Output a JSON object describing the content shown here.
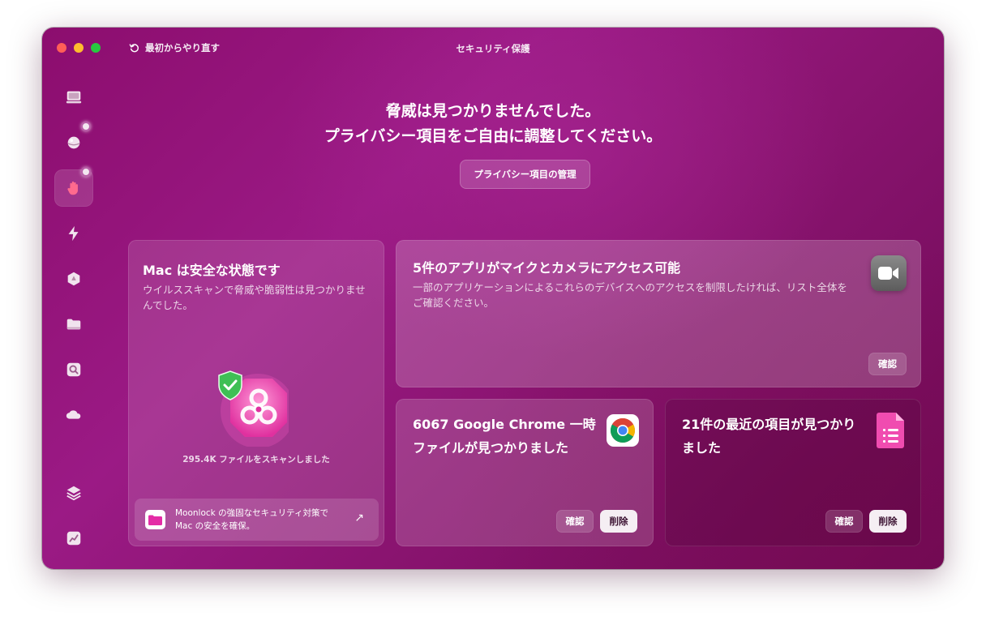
{
  "window": {
    "title": "セキュリティ保護",
    "restart_label": "最初からやり直す"
  },
  "sidebar": {
    "items": [
      {
        "icon": "monitor-icon"
      },
      {
        "icon": "cleanup-ball-icon",
        "badge": true
      },
      {
        "icon": "hand-privacy-icon",
        "badge": true,
        "active": true
      },
      {
        "icon": "lightning-icon"
      },
      {
        "icon": "apps-icon"
      },
      {
        "icon": "folder-icon"
      },
      {
        "icon": "magnifier-icon"
      },
      {
        "icon": "cloud-icon"
      },
      {
        "icon": "layers-icon"
      },
      {
        "icon": "chart-icon"
      }
    ]
  },
  "hero": {
    "line1": "脅威は見つかりませんでした。",
    "line2": "プライバシー項目をご自由に調整してください。",
    "manage_button": "プライバシー項目の管理"
  },
  "mac_card": {
    "title": "Mac は安全な状態です",
    "description": "ウイルススキャンで脅威や脆弱性は見つかりませんでした。",
    "scan_text": "295.4K ファイルをスキャンしました",
    "moonlock_line1": "Moonlock の強固なセキュリティ対策で",
    "moonlock_line2": "Mac の安全を確保。",
    "moonlock_arrow": "↗"
  },
  "mic_card": {
    "title": "5件のアプリがマイクとカメラにアクセス可能",
    "description": "一部のアプリケーションによるこれらのデバイスへのアクセスを制限したければ、リスト全体をご確認ください。",
    "review_button": "確認"
  },
  "chrome_card": {
    "title": "6067 Google Chrome 一時ファイルが見つかりました",
    "review_button": "確認",
    "delete_button": "削除"
  },
  "recent_card": {
    "title": "21件の最近の項目が見つかりました",
    "review_button": "確認",
    "delete_button": "削除"
  },
  "colors": {
    "accent": "#9b1a85",
    "close": "#ff5f57",
    "minimize": "#febc2e",
    "zoom": "#28c840"
  }
}
